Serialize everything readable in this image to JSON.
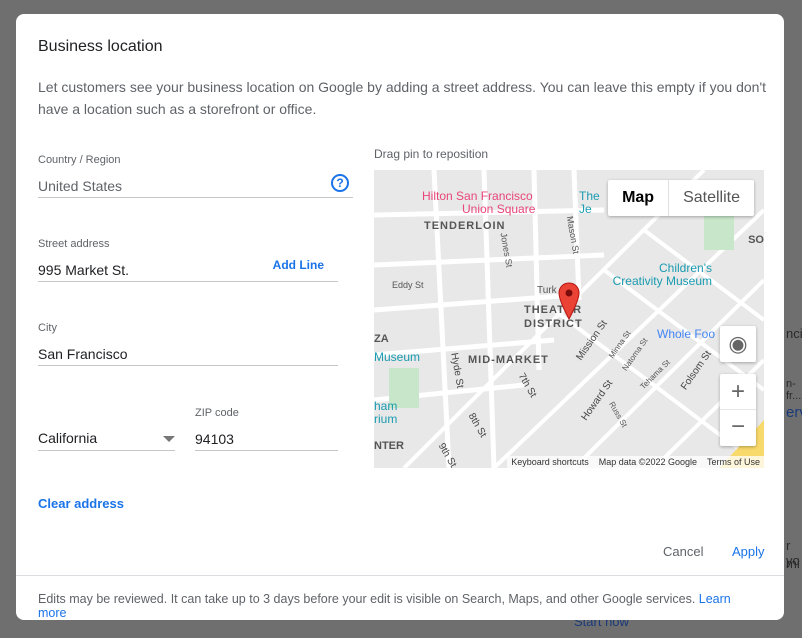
{
  "dialog": {
    "title": "Business location",
    "description": "Let customers see your business location on Google by adding a street address. You can leave this empty if you don't have a location such as a storefront or office."
  },
  "form": {
    "country": {
      "label": "Country / Region",
      "value": "United States",
      "help_icon": "help-circle-icon"
    },
    "street": {
      "label": "Street address",
      "value": "995 Market St.",
      "add_line": "Add Line"
    },
    "city": {
      "label": "City",
      "value": "San Francisco"
    },
    "state": {
      "value": "California"
    },
    "zip": {
      "label": "ZIP code",
      "value": "94103"
    },
    "clear": "Clear address"
  },
  "map": {
    "hint": "Drag pin to reposition",
    "type_map": "Map",
    "type_satellite": "Satellite",
    "labels": {
      "hilton": "Hilton San Francisco",
      "union": "Union Square",
      "tenderloin": "TENDERLOIN",
      "theater1": "THEATER",
      "theater2": "DISTRICT",
      "midmarket": "MID-MARKET",
      "childrens": "Children's",
      "creativity": "Creativity Museum",
      "whole": "Whole Foo",
      "museum": "Museum",
      "mission": "Mission St",
      "howard": "Howard St",
      "folsom": "Folsom St",
      "seventh": "7th St",
      "eighth": "8th St",
      "ninth": "9th St",
      "hyde": "Hyde St",
      "jones": "Jones St",
      "mason": "Mason St",
      "eddy": "Eddy St",
      "turk": "Turk",
      "minna": "Minna St",
      "natoma": "Natoma St",
      "tehama": "Tehama St",
      "russ": "Russ St",
      "so": "SO",
      "the": "The",
      "je": "Je",
      "nter": "NTER",
      "ham": "ham",
      "rium": "rium",
      "za": "ZA",
      "st": "St"
    },
    "attribution": {
      "shortcuts": "Keyboard shortcuts",
      "data": "Map data ©2022 Google",
      "terms": "Terms of Use"
    },
    "colors": {
      "pin": "#ea4335",
      "poi_pink": "#e8457a",
      "poi_teal": "#1a9bb0",
      "park": "#c8e6c9"
    }
  },
  "actions": {
    "cancel": "Cancel",
    "apply": "Apply"
  },
  "footer": {
    "text": "Edits may be reviewed. It can take up to 3 days before your edit is visible on Search, Maps, and other Google services.",
    "learn_more": "Learn more"
  },
  "background": {
    "t1": "ncis",
    "t2": "n-fr...",
    "t3": "erv",
    "t4": "r yo",
    "t5": "mi",
    "t6": "Start now"
  }
}
